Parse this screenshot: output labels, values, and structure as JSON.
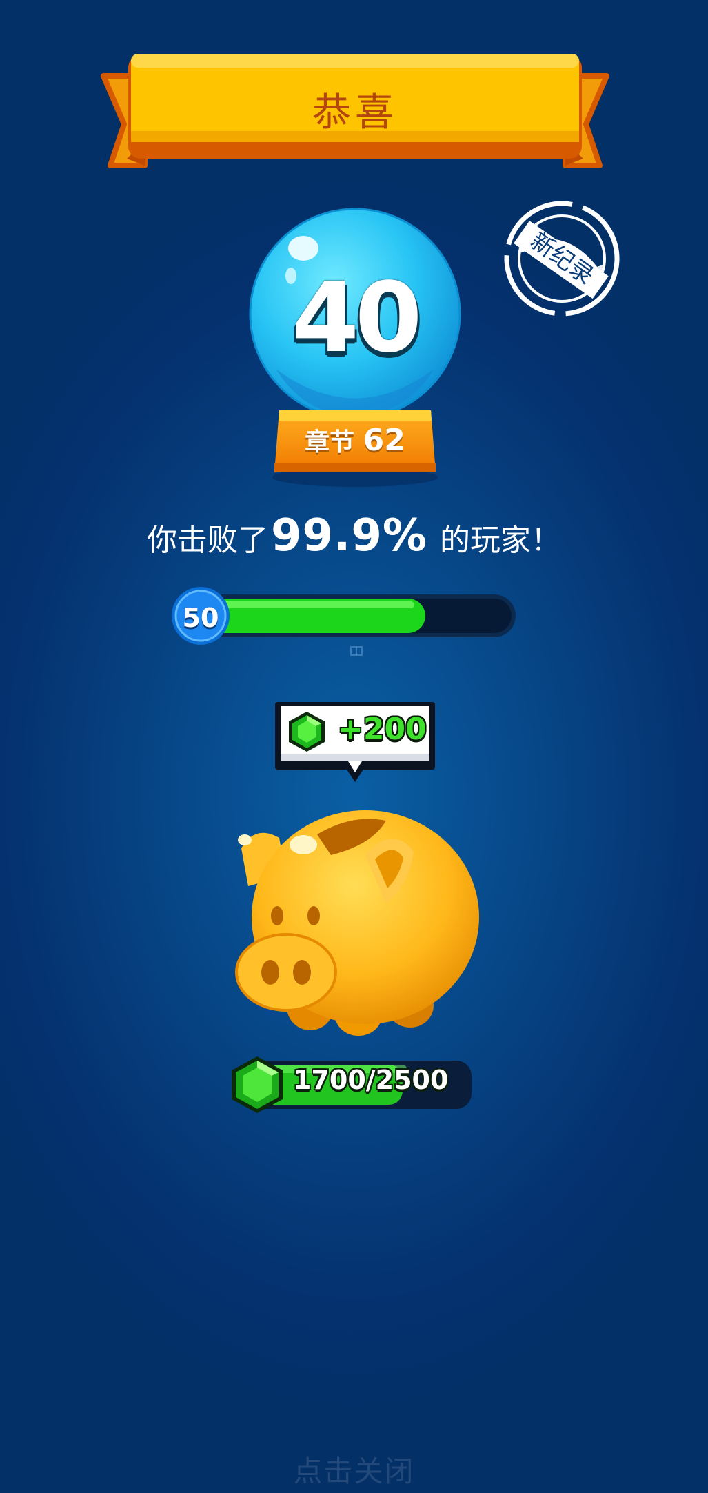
{
  "banner": {
    "title": "恭喜"
  },
  "stamp": {
    "label": "新纪录"
  },
  "globe": {
    "level": "40",
    "chapter_label": "章节",
    "chapter_number": "62"
  },
  "result": {
    "prefix": "你击败了",
    "percent": "99.9%",
    "suffix": " 的玩家！"
  },
  "progress": {
    "level": "50",
    "fill_fraction": 0.72
  },
  "reward": {
    "icon": "green-gem-icon",
    "amount": "+200"
  },
  "bank": {
    "icon": "green-gem-icon",
    "current": 1700,
    "max": 2500,
    "text": "1700/2500"
  },
  "footer": {
    "close_hint": "点击关闭"
  },
  "colors": {
    "background": "#053270",
    "banner": "#ffc400",
    "progress_fill": "#1bd61b",
    "reward_text": "#3fe02b"
  }
}
